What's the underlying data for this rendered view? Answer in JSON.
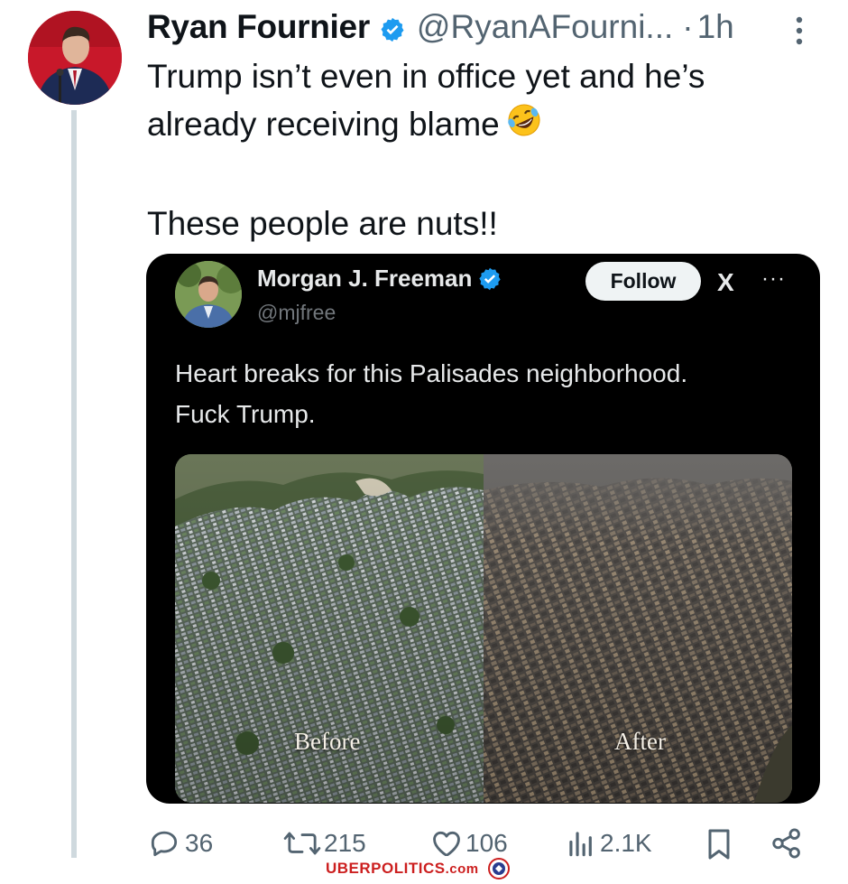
{
  "post": {
    "author_name": "Ryan Fournier",
    "author_handle": "@RyanAFourni...",
    "separator": "·",
    "time": "1h",
    "text_line1": "Trump isn’t even in office yet and he’s",
    "text_line2": "already receiving blame",
    "text_line3": "These people are nuts!!",
    "emoji": "rolling-on-floor-laughing-emoji"
  },
  "quoted": {
    "author_name": "Morgan J. Freeman",
    "author_handle": "@mjfree",
    "follow_label": "Follow",
    "x_logo": "X",
    "more": "···",
    "text_line1": "Heart breaks for this Palisades neighborhood.",
    "text_line2": "Fuck Trump.",
    "photo_before_label": "Before",
    "photo_after_label": "After"
  },
  "actions": {
    "replies": "36",
    "reposts": "215",
    "likes": "106",
    "views": "2.1K"
  },
  "watermark": {
    "text": "UBERPOLITICS",
    "suffix": ".com"
  },
  "colors": {
    "verified": "#1d9bf0",
    "muted": "#536471",
    "quote_bg": "#000000",
    "watermark": "#cc1f1f"
  }
}
